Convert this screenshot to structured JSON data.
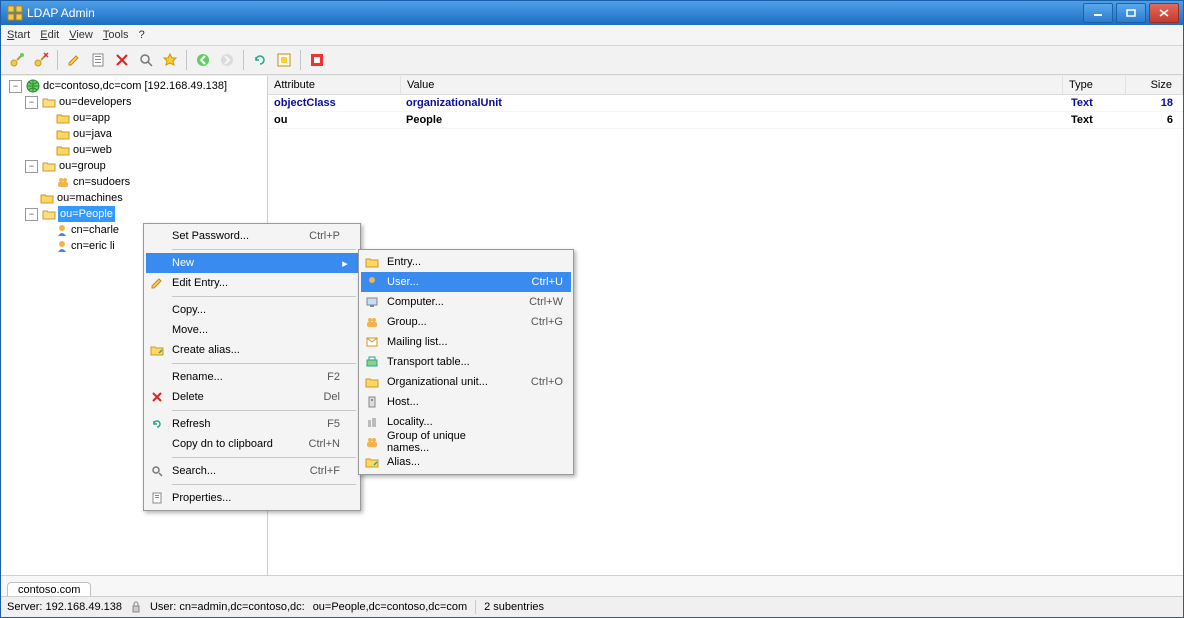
{
  "window": {
    "title": "LDAP Admin"
  },
  "menubar": {
    "start": "Start",
    "edit": "Edit",
    "view": "View",
    "tools": "Tools",
    "help": "?"
  },
  "tree": {
    "root": "dc=contoso,dc=com [192.168.49.138]",
    "developers": "ou=developers",
    "app": "ou=app",
    "java": "ou=java",
    "web": "ou=web",
    "group": "ou=group",
    "sudoers": "cn=sudoers",
    "machines": "ou=machines",
    "people": "ou=People",
    "charles": "cn=charle",
    "eric": "cn=eric li"
  },
  "grid": {
    "headers": {
      "attr": "Attribute",
      "val": "Value",
      "type": "Type",
      "size": "Size"
    },
    "rows": [
      {
        "attr": "objectClass",
        "val": "organizationalUnit",
        "type": "Text",
        "size": "18"
      },
      {
        "attr": "ou",
        "val": "People",
        "type": "Text",
        "size": "6"
      }
    ]
  },
  "context": {
    "setpw": "Set Password...",
    "setpw_sc": "Ctrl+P",
    "new": "New",
    "edit": "Edit Entry...",
    "copy": "Copy...",
    "move": "Move...",
    "alias": "Create alias...",
    "rename": "Rename...",
    "rename_sc": "F2",
    "delete": "Delete",
    "delete_sc": "Del",
    "refresh": "Refresh",
    "refresh_sc": "F5",
    "copydn": "Copy dn to clipboard",
    "copydn_sc": "Ctrl+N",
    "search": "Search...",
    "search_sc": "Ctrl+F",
    "props": "Properties..."
  },
  "submenu": {
    "entry": "Entry...",
    "user": "User...",
    "user_sc": "Ctrl+U",
    "computer": "Computer...",
    "computer_sc": "Ctrl+W",
    "group": "Group...",
    "group_sc": "Ctrl+G",
    "mailing": "Mailing list...",
    "transport": "Transport table...",
    "ou": "Organizational unit...",
    "ou_sc": "Ctrl+O",
    "host": "Host...",
    "locality": "Locality...",
    "guon": "Group of unique names...",
    "alias": "Alias..."
  },
  "tab": {
    "name": "contoso.com"
  },
  "status": {
    "server": "Server: 192.168.49.138",
    "user": "User: cn=admin,dc=contoso,dc:",
    "path": "ou=People,dc=contoso,dc=com",
    "subs": "2 subentries"
  }
}
